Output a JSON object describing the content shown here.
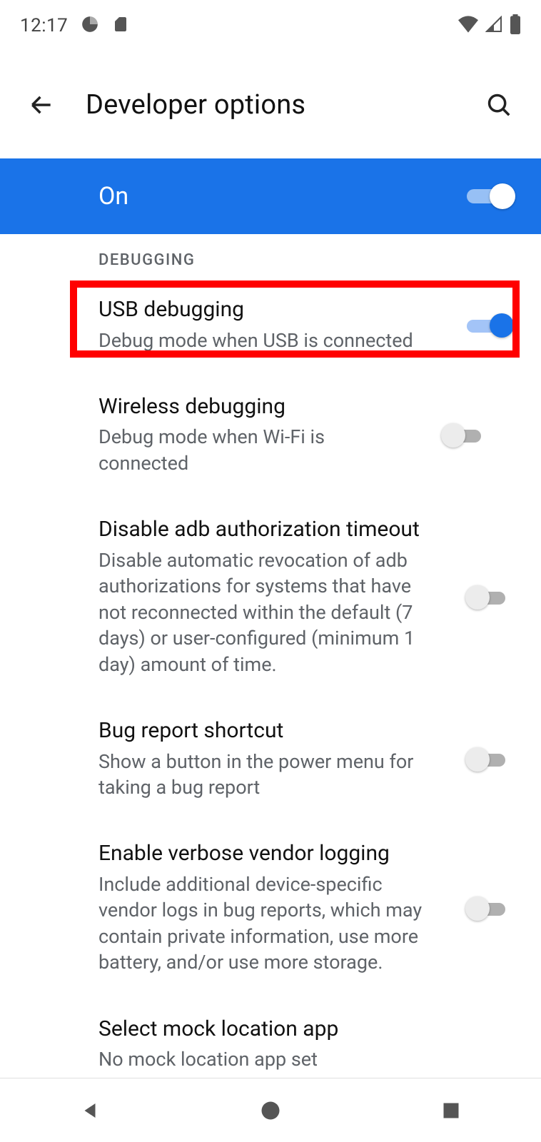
{
  "status": {
    "time": "12:17"
  },
  "header": {
    "title": "Developer options"
  },
  "master": {
    "label": "On",
    "enabled": true
  },
  "section_debugging": "DEBUGGING",
  "items": [
    {
      "title": "USB debugging",
      "desc": "Debug mode when USB is connected",
      "enabled": true,
      "highlighted": true
    },
    {
      "title": "Wireless debugging",
      "desc": "Debug mode when Wi-Fi is connected",
      "enabled": false,
      "divider": true
    },
    {
      "title": "Disable adb authorization timeout",
      "desc": "Disable automatic revocation of adb authorizations for systems that have not reconnected within the default (7 days) or user-configured (minimum 1 day) amount of time.",
      "enabled": false
    },
    {
      "title": "Bug report shortcut",
      "desc": "Show a button in the power menu for taking a bug report",
      "enabled": false
    },
    {
      "title": "Enable verbose vendor logging",
      "desc": "Include additional device-specific vendor logs in bug reports, which may contain private information, use more battery, and/or use more storage.",
      "enabled": false
    },
    {
      "title": "Select mock location app",
      "desc": "No mock location app set",
      "no_switch": true
    }
  ]
}
